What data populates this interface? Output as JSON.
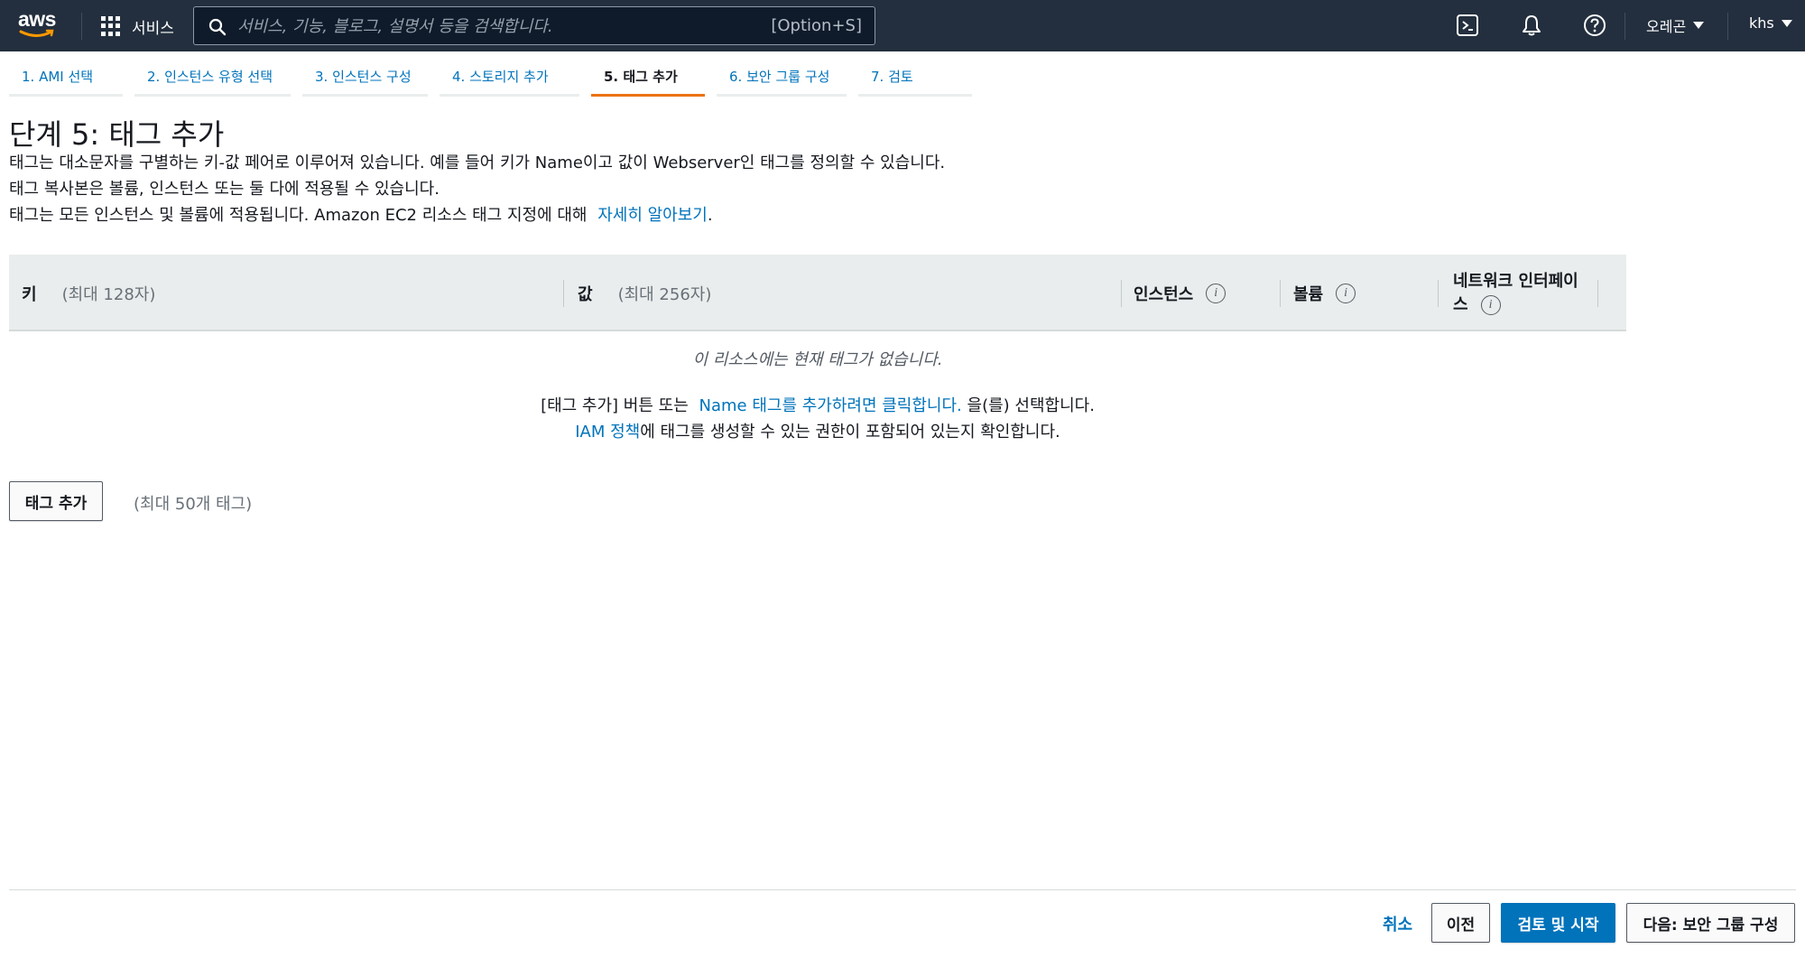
{
  "topnav": {
    "logo_text": "aws",
    "services_label": "서비스",
    "search_placeholder": "서비스, 기능, 블로그, 설명서 등을 검색합니다.",
    "search_shortcut": "[Option+S]",
    "region_label": "오레곤",
    "user_label": "khs",
    "icons": [
      "cloudshell-icon",
      "notifications-bell-icon",
      "help-icon"
    ]
  },
  "tabs": [
    {
      "label": "1. AMI 선택",
      "active": false
    },
    {
      "label": "2. 인스턴스 유형 선택",
      "active": false
    },
    {
      "label": "3. 인스턴스 구성",
      "active": false
    },
    {
      "label": "4. 스토리지 추가",
      "active": false
    },
    {
      "label": "5. 태그 추가",
      "active": true
    },
    {
      "label": "6. 보안 그룹 구성",
      "active": false
    },
    {
      "label": "7. 검토",
      "active": false
    }
  ],
  "page": {
    "title": "단계 5: 태그 추가",
    "desc_line1": "태그는 대소문자를 구별하는 키-값 페어로 이루어져 있습니다. 예를 들어 키가 Name이고 값이 Webserver인 태그를 정의할 수 있습니다.",
    "desc_line2": "태그 복사본은 볼륨, 인스턴스 또는 둘 다에 적용될 수 있습니다.",
    "desc_line3": "태그는 모든 인스턴스 및 볼륨에 적용됩니다. Amazon EC2 리소스 태그 지정에 대해",
    "learn_more": "자세히 알아보기",
    "desc_line3_end": "."
  },
  "table": {
    "col_key": "키",
    "col_key_hint": "(최대 128자)",
    "col_value": "값",
    "col_value_hint": "(최대 256자)",
    "col_instances": "인스턴스",
    "col_volumes": "볼륨",
    "col_network_line1": "네트워크 인터페이",
    "col_network_line2": "스",
    "info_glyph": "i",
    "empty_message": "이 리소스에는 현재 태그가 없습니다.",
    "empty_line1_pre": "[태그 추가] 버튼 또는",
    "empty_line1_link": "Name 태그를 추가하려면 클릭합니다.",
    "empty_line1_post": "을(를) 선택합니다.",
    "empty_line2_link": "IAM 정책",
    "empty_line2_post": "에 태그를 생성할 수 있는 권한이 포함되어 있는지 확인합니다."
  },
  "actions": {
    "add_tag_label": "태그 추가",
    "add_tag_note": "(최대 50개 태그)",
    "cancel_label": "취소",
    "previous_label": "이전",
    "review_launch_label": "검토 및 시작",
    "next_label": "다음: 보안 그룹 구성"
  },
  "colors": {
    "nav_bg": "#232f3e",
    "link": "#0073bb",
    "active_tab_underline": "#ec7211",
    "primary_button": "#0073bb",
    "table_header_bg": "#eaeded"
  }
}
